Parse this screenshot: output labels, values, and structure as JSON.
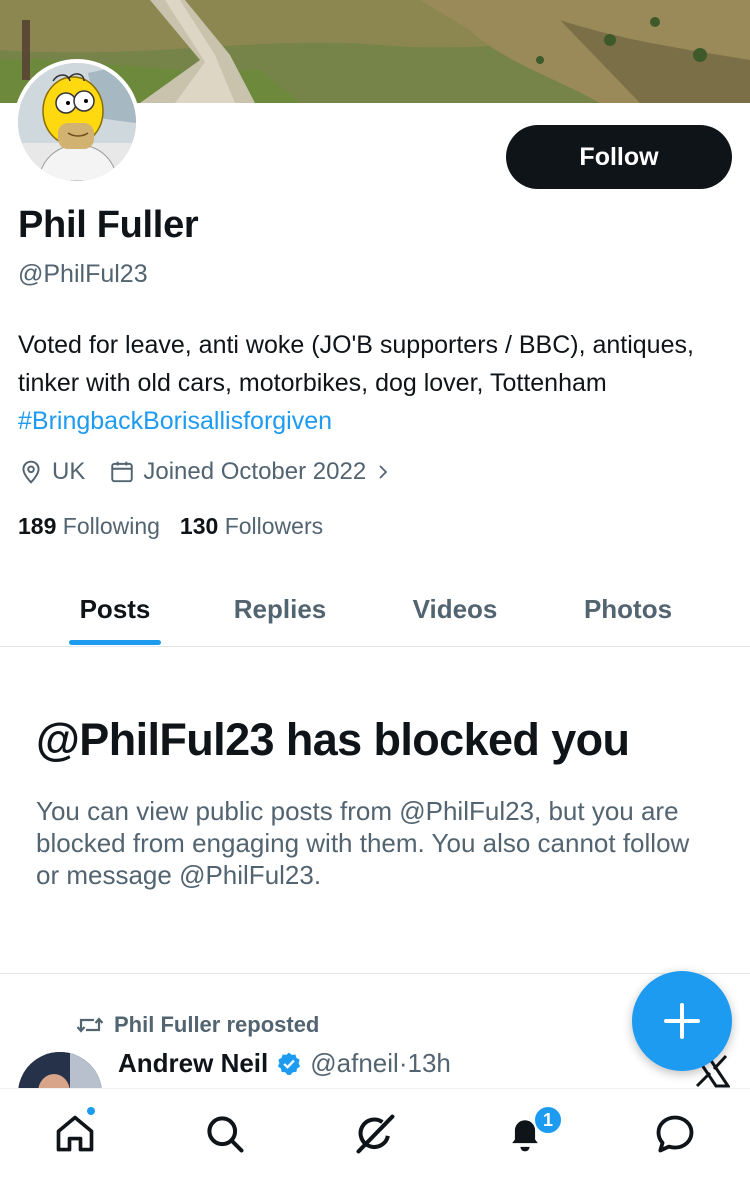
{
  "profile": {
    "name": "Phil Fuller",
    "handle": "@PhilFul23",
    "bio_text": "Voted for leave, anti woke (JO'B supporters / BBC), antiques, tinker with old cars, motorbikes, dog lover, Tottenham ",
    "bio_hashtag": "#BringbackBorisallisforgiven",
    "location": "UK",
    "joined": "Joined October 2022",
    "following_count": "189",
    "following_label": "Following",
    "followers_count": "130",
    "followers_label": "Followers",
    "follow_button": "Follow"
  },
  "tabs": [
    {
      "label": "Posts",
      "active": true
    },
    {
      "label": "Replies",
      "active": false
    },
    {
      "label": "Videos",
      "active": false
    },
    {
      "label": "Photos",
      "active": false
    }
  ],
  "blocked": {
    "title": "@PhilFul23 has blocked you",
    "description": "You can view public posts from @PhilFul23, but you are blocked from engaging with them. You also cannot follow or message @PhilFul23."
  },
  "post": {
    "repost_label": "Phil Fuller reposted",
    "author_name": "Andrew Neil",
    "author_handle": "@afneil",
    "separator": " · ",
    "time": "13h"
  },
  "nav": {
    "notifications_badge": "1",
    "items": [
      "home-icon",
      "search-icon",
      "grok-icon",
      "bell-icon",
      "messages-icon"
    ]
  },
  "colors": {
    "accent": "#1d9bf0",
    "text": "#0f1419",
    "muted": "#536471",
    "follow_bg": "#0f1419"
  }
}
